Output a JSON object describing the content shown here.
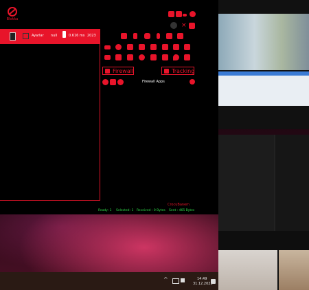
{
  "app": {
    "brand": "Blokka",
    "status": {
      "name": "Ayarlar",
      "mode": "null",
      "latency": "0.616 ms",
      "year": "2023"
    },
    "buttons": {
      "firewall": "Firewall",
      "tracking": "Tracking"
    },
    "panel_title": "Firewall Apps",
    "author": "CrocuBanem",
    "footer": {
      "ready": "Ready: 1",
      "selected": "Selected: 1",
      "received": "Received : 0 Bytes",
      "sent": "Sent : 465 Bytes"
    }
  },
  "taskbar": {
    "time": "14:49",
    "date": "31.12.2023",
    "chevron": "^"
  },
  "colors": {
    "accent": "#e8142a",
    "status_green": "#2fe04a"
  }
}
